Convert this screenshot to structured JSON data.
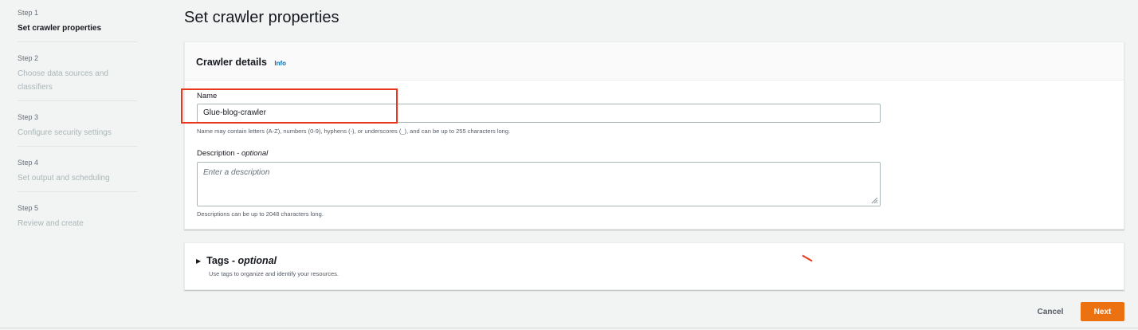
{
  "steps": [
    {
      "num": "Step 1",
      "title": "Set crawler properties"
    },
    {
      "num": "Step 2",
      "title": "Choose data sources and classifiers"
    },
    {
      "num": "Step 3",
      "title": "Configure security settings"
    },
    {
      "num": "Step 4",
      "title": "Set output and scheduling"
    },
    {
      "num": "Step 5",
      "title": "Review and create"
    }
  ],
  "page_title": "Set crawler properties",
  "details": {
    "title": "Crawler details",
    "info": "Info",
    "name_label": "Name",
    "name_value": "Glue-blog-crawler",
    "name_hint": "Name may contain letters (A-Z), numbers (0-9), hyphens (-), or underscores (_), and can be up to 255 characters long.",
    "desc_label": "Description - ",
    "desc_optional": "optional",
    "desc_placeholder": "Enter a description",
    "desc_hint": "Descriptions can be up to 2048 characters long."
  },
  "tags": {
    "title": "Tags - ",
    "optional": "optional",
    "desc": "Use tags to organize and identify your resources."
  },
  "footer": {
    "cancel": "Cancel",
    "next": "Next"
  },
  "colors": {
    "accent": "#ec7211",
    "link": "#0073bb",
    "highlight": "#e8371c"
  }
}
